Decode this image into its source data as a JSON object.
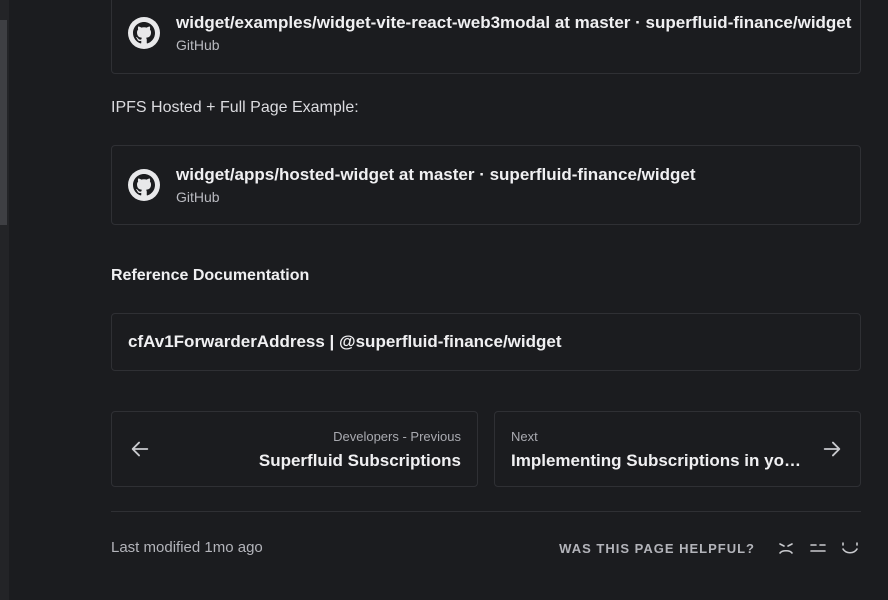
{
  "cards": [
    {
      "title": "widget/examples/widget-vite-react-web3modal at master · superfluid-finance/widget",
      "source": "GitHub",
      "icon": "github-icon"
    },
    {
      "title": "widget/apps/hosted-widget at master · superfluid-finance/widget",
      "source": "GitHub",
      "icon": "github-icon"
    }
  ],
  "ipfs_paragraph": "IPFS Hosted + Full Page Example:",
  "reference_heading": "Reference Documentation",
  "reference_link": "cfAv1ForwarderAddress | @superfluid-finance/widget",
  "nav": {
    "previous": {
      "label": "Developers - Previous",
      "title": "Superfluid Subscriptions",
      "icon": "arrow-left-icon"
    },
    "next": {
      "label": "Next",
      "title": "Implementing Subscriptions in your …",
      "icon": "arrow-right-icon"
    }
  },
  "footer": {
    "last_modified": "Last modified 1mo ago",
    "helpful_label": "WAS THIS PAGE HELPFUL?",
    "ratings": [
      "sad-face-icon",
      "neutral-face-icon",
      "happy-face-icon"
    ]
  },
  "colors": {
    "background": "#1b1c1f",
    "border": "#2f3034",
    "text": "#f0f0f2"
  }
}
